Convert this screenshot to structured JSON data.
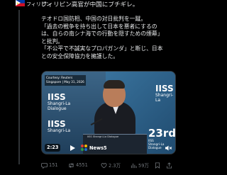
{
  "account_label": "フィリピン",
  "headline": "フィリピン高官が中国にブチギレ。",
  "body_lines": [
    "テオドロ国防相、中国の対日批判を一蹴。",
    "「過去の戦争を持ち出して日本を悪者にするの",
    "は、自らの南シナ海での行動を隠すための煙幕」",
    "と批判。",
    "「不公平で不誠実なプロパガンダ」と断じ、日本",
    "との安全保障協力を擁護した。"
  ],
  "media": {
    "credit_lines": [
      "Courtesy: Reuters",
      "Singapore | May 31, 2026"
    ],
    "logo_left_title": "IISS",
    "logo_left_sub": [
      "Shangri-La",
      "Dialogue"
    ],
    "podium_text": "IISS Shangri-La Dialogue",
    "anniversary_number": "23rd",
    "anniversary_sub": [
      "IISS",
      "Shangri-La",
      "Dialogue"
    ],
    "logo_right_title": "IISS",
    "logo_right_sub": "Shangri-La",
    "duration": "2:23",
    "news_source": "News5"
  },
  "actions": {
    "replies": "151",
    "reposts": "4551",
    "likes": "2.3万",
    "views": "59万"
  },
  "colors": {
    "background": "#000000",
    "text": "#e7e9ea",
    "muted": "#71767b"
  }
}
